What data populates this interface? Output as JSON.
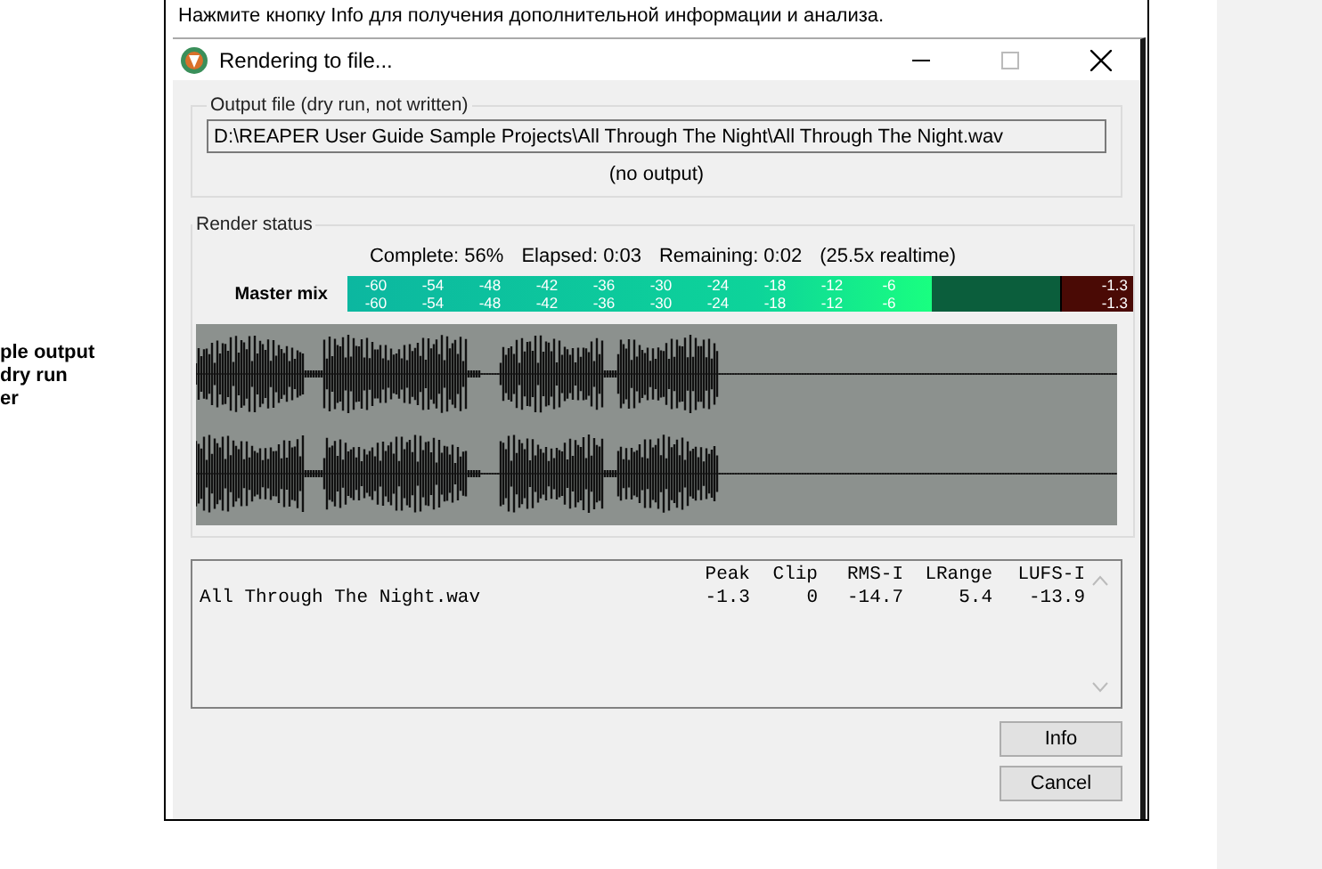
{
  "document": {
    "intro": "Нажмите кнопку Info для получения дополнительной информации и анализа.",
    "side_note_lines": [
      "ple output",
      "dry run",
      "er"
    ]
  },
  "window": {
    "title": "Rendering to file..."
  },
  "output_group": {
    "title": "Output file (dry run, not written)",
    "path": "D:\\REAPER User Guide Sample Projects\\All Through The Night\\All Through The Night.wav",
    "note": "(no output)"
  },
  "render_status": {
    "title": "Render status",
    "complete": "Complete: 56%",
    "elapsed": "Elapsed: 0:03",
    "remaining": "Remaining: 0:02",
    "speed": "(25.5x realtime)",
    "meter": {
      "label": "Master mix",
      "channels": [
        {
          "scale": [
            "-60",
            "-54",
            "-48",
            "-42",
            "-36",
            "-30",
            "-24",
            "-18",
            "-12",
            "-6"
          ],
          "level": 0.82,
          "peak": "-1.3"
        },
        {
          "scale": [
            "-60",
            "-54",
            "-48",
            "-42",
            "-36",
            "-30",
            "-24",
            "-18",
            "-12",
            "-6"
          ],
          "level": 0.82,
          "peak": "-1.3"
        }
      ]
    }
  },
  "results": {
    "columns": [
      "Peak",
      "Clip",
      "RMS-I",
      "LRange",
      "LUFS-I"
    ],
    "rows": [
      {
        "file": "All Through The Night.wav",
        "values": [
          "-1.3",
          "0",
          "-14.7",
          "5.4",
          "-13.9"
        ]
      }
    ]
  },
  "buttons": [
    {
      "label": "Info"
    },
    {
      "label": "Cancel"
    }
  ]
}
